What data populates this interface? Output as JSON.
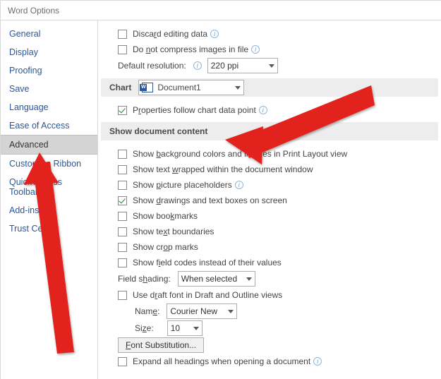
{
  "title": "Word Options",
  "sidebar": {
    "items": [
      {
        "label": "General"
      },
      {
        "label": "Display"
      },
      {
        "label": "Proofing"
      },
      {
        "label": "Save"
      },
      {
        "label": "Language"
      },
      {
        "label": "Ease of Access"
      },
      {
        "label": "Advanced"
      },
      {
        "label": "Customize Ribbon"
      },
      {
        "label": "Quick Access Toolbar"
      },
      {
        "label": "Add-ins"
      },
      {
        "label": "Trust Center"
      }
    ],
    "selected": "Advanced"
  },
  "main": {
    "discard_editing": "Discard editing data",
    "dont_compress": "Do not compress images in file",
    "default_res_label": "Default resolution:",
    "default_res_value": "220 ppi",
    "chart_section": "Chart",
    "chart_doc": "Document1",
    "props_follow": "Properties follow chart data point",
    "show_content_section": "Show document content",
    "opt_bg": "Show background colors and images in Print Layout view",
    "opt_wrap": "Show text wrapped within the document window",
    "opt_pic": "Show picture placeholders",
    "opt_draw": "Show drawings and text boxes on screen",
    "opt_book": "Show bookmarks",
    "opt_bound": "Show text boundaries",
    "opt_crop": "Show crop marks",
    "opt_fieldcodes": "Show field codes instead of their values",
    "field_shading_label": "Field shading:",
    "field_shading_value": "When selected",
    "draft_font": "Use draft font in Draft and Outline views",
    "name_label": "Name:",
    "name_value": "Courier New",
    "size_label": "Size:",
    "size_value": "10",
    "font_sub": "Font Substitution...",
    "expand_all": "Expand all headings when opening a document"
  }
}
